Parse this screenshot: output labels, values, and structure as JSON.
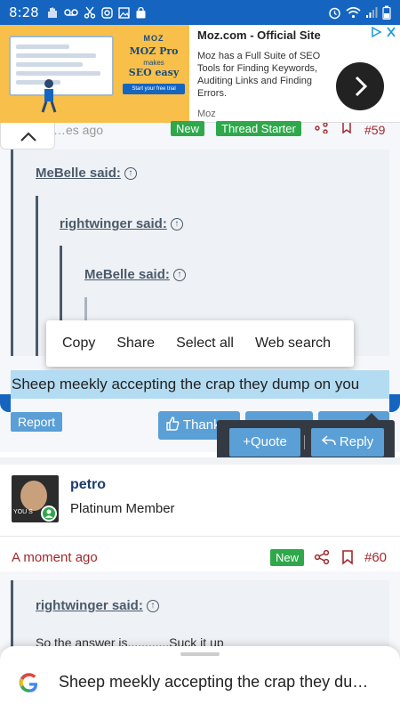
{
  "status_bar": {
    "time": "8:28",
    "left_icons": [
      "hand-icon",
      "voicemail-icon",
      "scissors-icon",
      "instagram-icon",
      "image-icon",
      "bag-icon"
    ],
    "right_icons": [
      "alarm-icon",
      "wifi-icon",
      "signal-icon",
      "battery-icon"
    ]
  },
  "ad": {
    "image_brand": "MOZ",
    "image_product": "MOZ Pro",
    "image_makes": "makes",
    "image_tagline": "SEO easy",
    "image_cta": "Start your free trial",
    "title": "Moz.com - Official Site",
    "description": "Moz has a Full Suite of SEO Tools for Finding Keywords, Auditing Links and Finding Errors.",
    "source": "Moz"
  },
  "post1": {
    "partial_time": "…es ago",
    "badge_new": "New",
    "badge_starter": "Thread Starter",
    "post_number": "#59",
    "quotes": [
      {
        "label": "MeBelle said:"
      },
      {
        "label": "rightwinger said:"
      },
      {
        "label": "MeBelle said:"
      }
    ],
    "selected_text": "Sheep meekly accepting the crap they dump on you",
    "report_label": "Report",
    "thanks_label": "Thanks",
    "quote_label": "+Quote",
    "reply_label": "Reply"
  },
  "context_menu": {
    "items": [
      "Copy",
      "Share",
      "Select all",
      "Web search"
    ]
  },
  "post2": {
    "username": "petro",
    "user_title": "Platinum Member",
    "avatar_caption": "YOU S",
    "time": "A moment ago",
    "badge_new": "New",
    "post_number": "#60",
    "quote_label": "rightwinger said:",
    "quote_text": "So the answer is............Suck it up"
  },
  "google_bar": {
    "query": "Sheep meekly accepting the crap they du…"
  },
  "colors": {
    "status_bar": "#1565c0",
    "ad_image_bg": "#f8c04a",
    "selection": "#b3dbf2",
    "button_blue": "#5a9fd6",
    "new_badge": "#2ea84b",
    "post_meta_red": "#a0292d",
    "username_blue": "#1a3d6e"
  }
}
